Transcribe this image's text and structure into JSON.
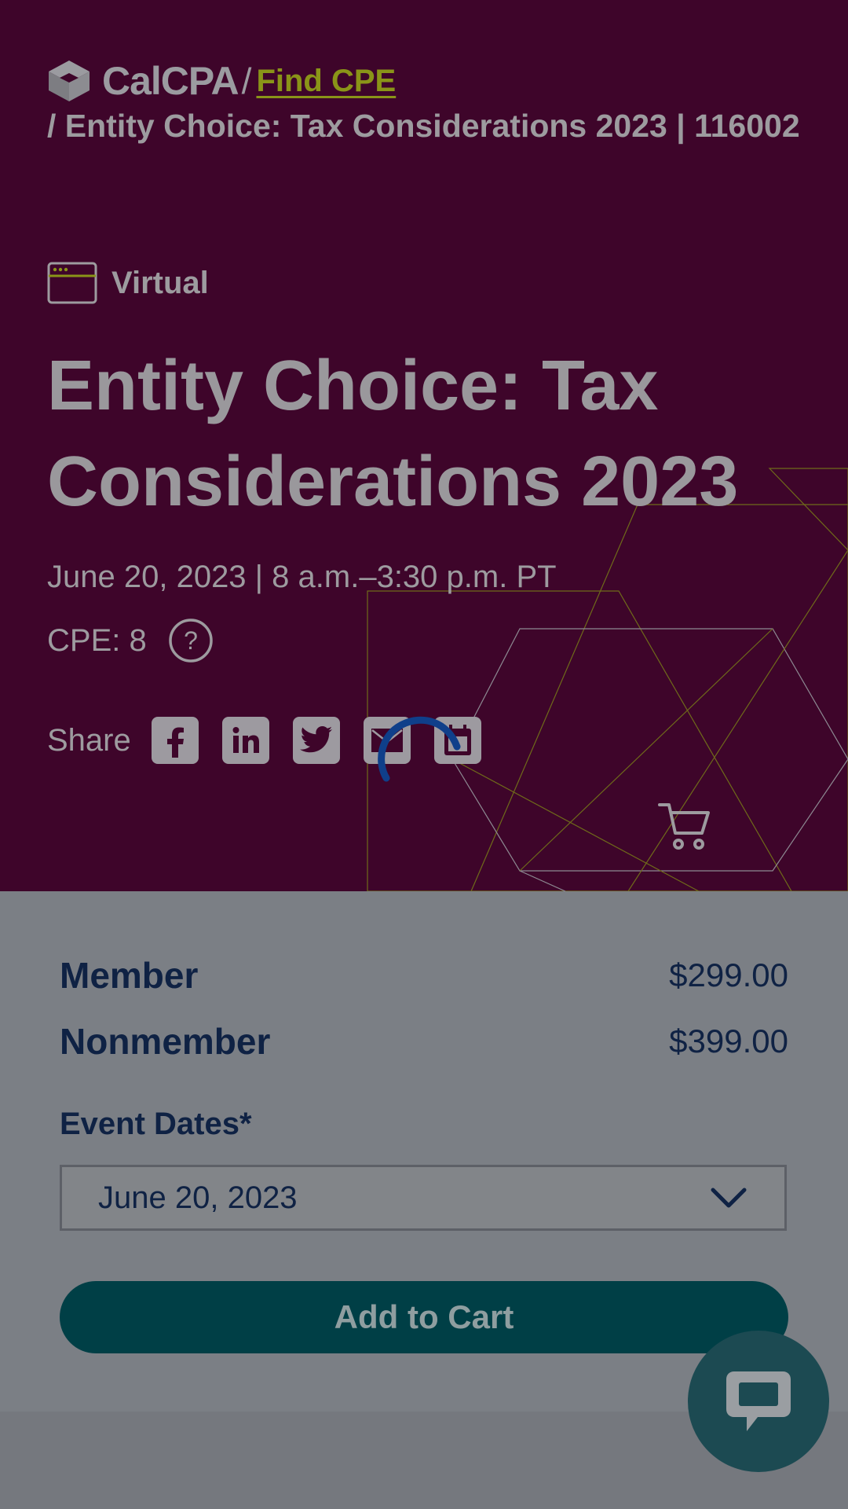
{
  "breadcrumb": {
    "logo_text": "CalCPA",
    "separator": "/",
    "link_label": "Find CPE",
    "current": "/ Entity Choice: Tax Considerations 2023 | 116002"
  },
  "event": {
    "format": "Virtual",
    "title": "Entity Choice: Tax Considerations 2023",
    "date_time": "June 20, 2023 | 8 a.m.–3:30 p.m. PT",
    "cpe": "CPE: 8",
    "share_label": "Share",
    "share_icons": [
      "facebook-icon",
      "linkedin-icon",
      "twitter-icon",
      "email-icon",
      "calendar-icon"
    ]
  },
  "pricing": {
    "member_label": "Member",
    "member_price": "$299.00",
    "nonmember_label": "Nonmember",
    "nonmember_price": "$399.00",
    "event_dates_label": "Event Dates*",
    "selected_date": "June 20, 2023",
    "add_to_cart": "Add to Cart"
  },
  "colors": {
    "hero_bg": "#3e052a",
    "link": "#8a9418",
    "primary_text": "#0f2244",
    "button": "#003f46",
    "chat": "#1c4a52",
    "spinner": "#0f3f8a"
  }
}
